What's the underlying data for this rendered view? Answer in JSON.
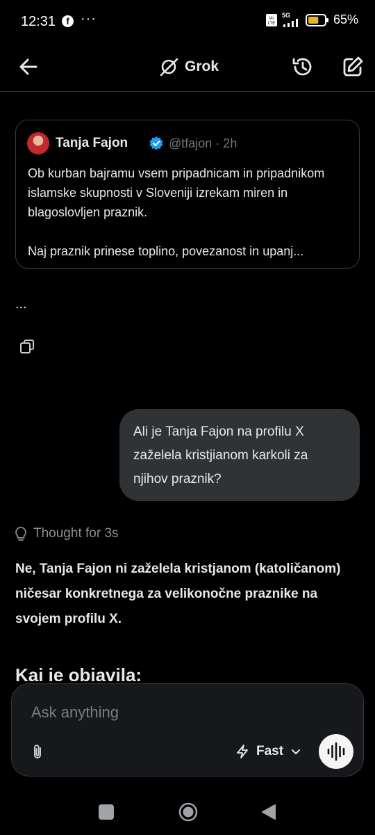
{
  "status_bar": {
    "time": "12:31",
    "notification_icon": "facebook-icon",
    "more_dots": "···",
    "network": "5G",
    "battery_percent": "65%",
    "battery_level": 0.65
  },
  "header": {
    "title": "Grok",
    "icons": [
      "back-arrow-icon",
      "grok-logo-icon",
      "history-icon",
      "compose-icon"
    ]
  },
  "quoted_post": {
    "author_name": "Tanja Fajon",
    "handle_time": "@tfajon · 2h",
    "text": "Ob kurban bajramu vsem pripadnicam in pripadnikom islamske skupnosti v Sloveniji izrekam miren in blagoslovljen praznik.\n\nNaj praznik prinese toplino, povezanost in upanj..."
  },
  "collapsed_marker": "...",
  "user_message": "Ali je Tanja Fajon na profilu X zaželela kristjianom karkoli za njihov praznik?",
  "response": {
    "thought_label": "Thought for 3s",
    "answer": "Ne, Tanja Fajon ni zaželela kristjanom (katoličanom) ničesar konkretnega za velikonočne praznike na svojem profilu X.",
    "next_heading": "Kaj je objavila:"
  },
  "composer": {
    "placeholder": "Ask anything",
    "mode_label": "Fast"
  },
  "colors": {
    "background": "#000000",
    "bubble": "#2f3336",
    "border": "#2f3336",
    "muted_text": "#71767b",
    "verified_blue": "#1d9bf0"
  }
}
